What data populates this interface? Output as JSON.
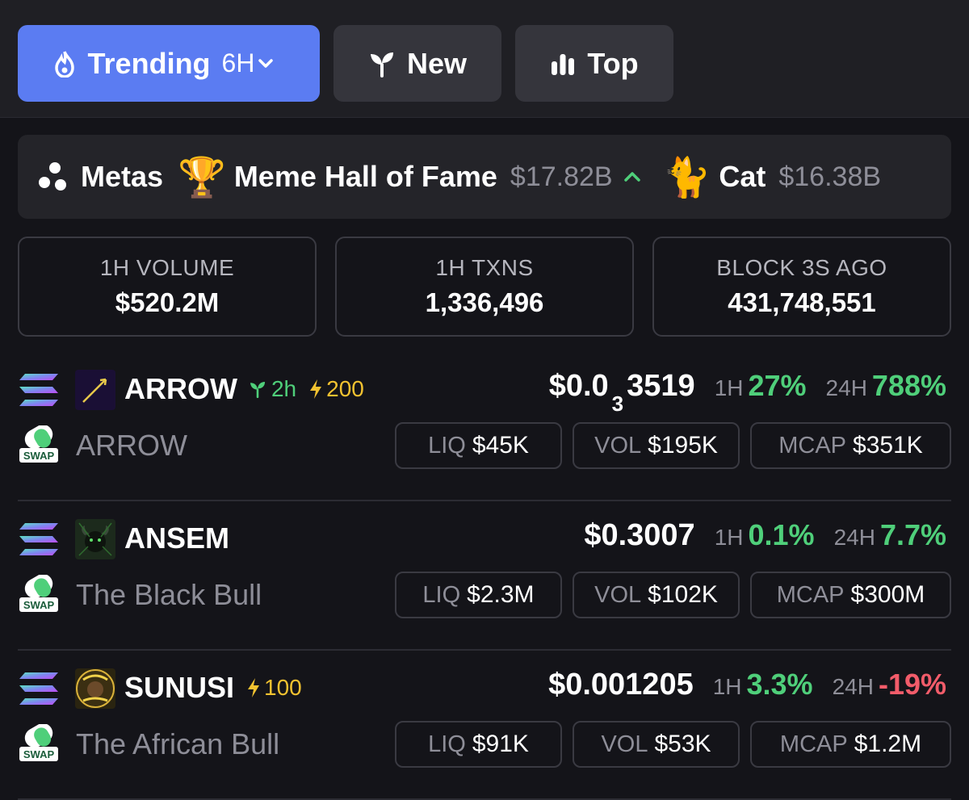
{
  "tabs": {
    "trending_label": "Trending",
    "timeframe": "6H",
    "new_label": "New",
    "top_label": "Top"
  },
  "metas": {
    "label": "Metas",
    "items": [
      {
        "emoji": "🏆",
        "name": "Meme Hall of Fame",
        "value": "$17.82B"
      },
      {
        "emoji": "🐈",
        "name": "Cat",
        "value": "$16.38B"
      }
    ]
  },
  "stats": [
    {
      "label": "1H VOLUME",
      "value": "$520.2M"
    },
    {
      "label": "1H TXNS",
      "value": "1,336,496"
    },
    {
      "label": "BLOCK 3S AGO",
      "value": "431,748,551"
    }
  ],
  "labels": {
    "h1": "1H",
    "h24": "24H",
    "liq": "LIQ",
    "vol": "VOL",
    "mcap": "MCAP",
    "swap": "SWAP"
  },
  "tokens": [
    {
      "symbol": "ARROW",
      "age": "2h",
      "boost": "200",
      "name": "ARROW",
      "price_prefix": "$0.0",
      "price_zeros": "3",
      "price_rest": "3519",
      "h1": "27%",
      "h24": "788%",
      "liq": "$45K",
      "vol": "$195K",
      "mcap": "$351K"
    },
    {
      "symbol": "ANSEM",
      "name": "The Black Bull",
      "price": "$0.3007",
      "h1": "0.1%",
      "h24": "7.7%",
      "liq": "$2.3M",
      "vol": "$102K",
      "mcap": "$300M"
    },
    {
      "symbol": "SUNUSI",
      "boost": "100",
      "name": "The African Bull",
      "price": "$0.001205",
      "h1": "3.3%",
      "h24": "-19%",
      "liq": "$91K",
      "vol": "$53K",
      "mcap": "$1.2M"
    }
  ],
  "colors": {
    "accent": "#5b7cf2",
    "positive": "#4fcf7a",
    "negative": "#f25c6a",
    "boost": "#f2c230"
  }
}
